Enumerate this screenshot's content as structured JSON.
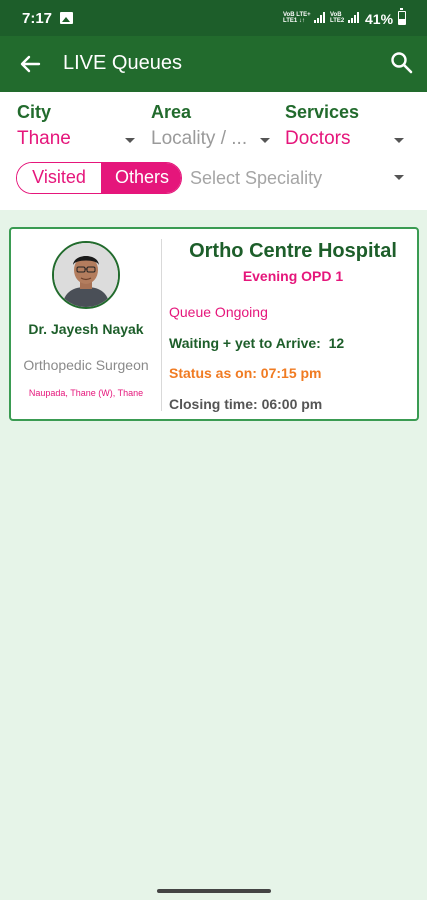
{
  "status_bar": {
    "time": "7:17",
    "net1": [
      "VoB LTE+",
      "LTE1 ↓↑"
    ],
    "net2": [
      "VoB",
      "LTE2"
    ],
    "battery": "41%"
  },
  "app_bar": {
    "title": "LIVE Queues",
    "back_icon": "arrow-left",
    "search_icon": "magnifier"
  },
  "filters": {
    "city": {
      "label": "City",
      "value": "Thane"
    },
    "area": {
      "label": "Area",
      "placeholder": "Locality / ..."
    },
    "services": {
      "label": "Services",
      "value": "Doctors"
    },
    "toggle": {
      "visited": "Visited",
      "others": "Others",
      "selected": "Others"
    },
    "speciality_placeholder": "Select Speciality"
  },
  "queue_card": {
    "doctor_name": "Dr. Jayesh Nayak",
    "speciality": "Orthopedic Surgeon",
    "address": "Naupada, Thane (W), Thane",
    "hospital": "Ortho Centre Hospital",
    "session": "Evening OPD 1",
    "queue_status": "Queue Ongoing",
    "waiting_label": "Waiting + yet to Arrive:",
    "waiting_count": "12",
    "status_label": "Status as on:",
    "status_time": "07:15 pm",
    "closing_label": "Closing time:",
    "closing_time": "06:00 pm"
  },
  "colors": {
    "primary_green": "#226b2d",
    "status_green": "#1d5e2a",
    "accent_pink": "#e5167b",
    "status_orange": "#f07b22",
    "background": "#e6f4e8"
  }
}
